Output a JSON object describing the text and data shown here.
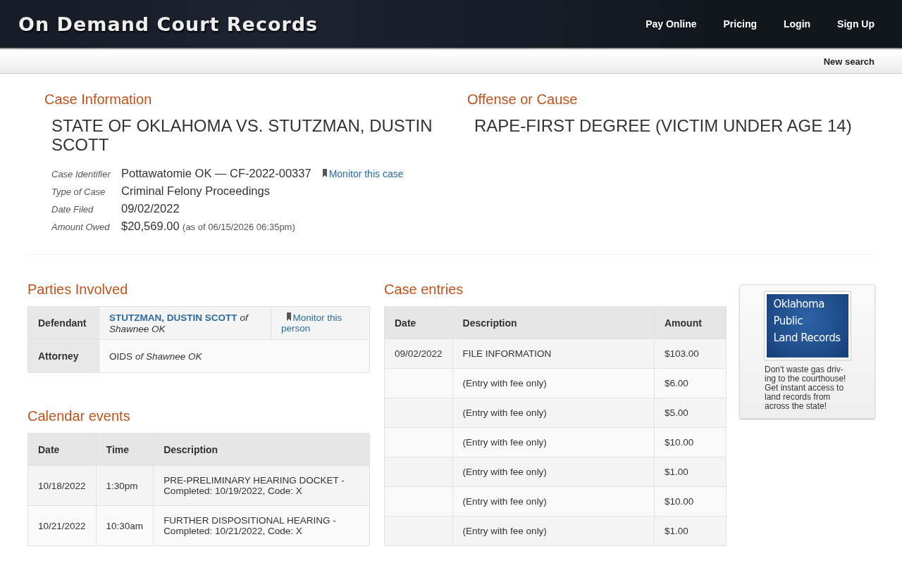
{
  "header": {
    "logo": "On Demand Court Records",
    "nav": [
      "Pay Online",
      "Pricing",
      "Login",
      "Sign Up"
    ]
  },
  "subnav": {
    "link": "New search"
  },
  "case_info": {
    "heading": "Case Information",
    "title": "STATE OF OKLAHOMA VS. STUTZMAN, DUSTIN SCOTT",
    "fields": [
      {
        "label": "Case Identifier",
        "value": "Pottawatomie OK — CF-2022-00337",
        "link": "Monitor this case"
      },
      {
        "label": "Type of Case",
        "value": "Criminal Felony Proceedings"
      },
      {
        "label": "Date Filed",
        "value": "09/02/2022"
      },
      {
        "label": "Amount Owed",
        "value": "$20,569.00",
        "note": "(as of 06/15/2026 06:35pm)"
      }
    ]
  },
  "offense": {
    "heading": "Offense or Cause",
    "text": "RAPE-FIRST DEGREE (VICTIM UNDER AGE 14)"
  },
  "parties": {
    "heading": "Parties Involved",
    "rows": [
      {
        "role": "Defendant",
        "name": "STUTZMAN, DUSTIN SCOTT",
        "kind": "link",
        "location": "of Shawnee OK",
        "action": "Monitor this person"
      },
      {
        "role": "Attorney",
        "name": "OIDS",
        "kind": "plain",
        "location": "of Shawnee OK"
      }
    ]
  },
  "calendar": {
    "heading": "Calendar events",
    "columns": [
      "Date",
      "Time",
      "Description"
    ],
    "rows": [
      [
        "10/18/2022",
        "1:30pm",
        "PRE-PRELIMINARY HEARING DOCKET - Completed: 10/19/2022, Code: X"
      ],
      [
        "10/21/2022",
        "10:30am",
        "FURTHER DISPOSITIONAL HEARING - Completed: 10/21/2022, Code: X"
      ]
    ]
  },
  "case_entries": {
    "heading": "Case entries",
    "columns": [
      "Date",
      "Description",
      "Amount"
    ],
    "rows": [
      [
        "09/02/2022",
        "FILE INFORMATION",
        "$103.00"
      ],
      [
        "",
        "(Entry with fee only)",
        "$6.00"
      ],
      [
        "",
        "(Entry with fee only)",
        "$5.00"
      ],
      [
        "",
        "(Entry with fee only)",
        "$10.00"
      ],
      [
        "",
        "(Entry with fee only)",
        "$1.00"
      ],
      [
        "",
        "(Entry with fee only)",
        "$10.00"
      ],
      [
        "",
        "(Entry with fee only)",
        "$1.00"
      ]
    ]
  },
  "ad": {
    "banner_lines": [
      "Oklahoma",
      "Public",
      "Land Records"
    ],
    "text": "Don't waste gas driv-ing to the courthouse! Get instant access to land records from across the state!"
  }
}
